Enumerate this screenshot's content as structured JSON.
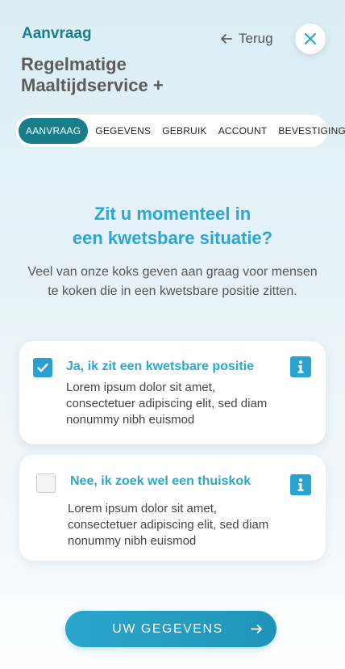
{
  "header": {
    "label": "Aanvraag",
    "back_label": "Terug",
    "title": "Regelmatige Maaltijdservice +"
  },
  "steps": [
    {
      "label": "Aanvraag",
      "active": true
    },
    {
      "label": "Gegevens",
      "active": false
    },
    {
      "label": "Gebruik",
      "active": false
    },
    {
      "label": "Account",
      "active": false
    },
    {
      "label": "Bevestiging",
      "active": false
    }
  ],
  "question": {
    "line1": "Zit u momenteel in",
    "line2": "een kwetsbare situatie?",
    "intro": "Veel van onze koks geven aan graag voor mensen te koken die in een kwetsbare positie zitten."
  },
  "options": [
    {
      "title": "Ja, ik zit een kwetsbare positie",
      "description": "Lorem ipsum dolor sit amet, consectetuer adipiscing elit, sed diam nonummy nibh euismod",
      "checked": true
    },
    {
      "title": "Nee, ik zoek wel een thuiskok",
      "description": "Lorem ipsum dolor sit amet, consectetuer adipiscing elit, sed diam nonummy nibh euismod",
      "checked": false
    }
  ],
  "cta": {
    "label": "UW GEGEVENS"
  },
  "colors": {
    "accent": "#2aa8cf",
    "brand_dark": "#177e8a",
    "text": "#444444"
  },
  "icons": {
    "back": "arrow-left-icon",
    "close": "close-icon",
    "check": "check-icon",
    "info": "info-icon",
    "next": "arrow-right-icon"
  }
}
